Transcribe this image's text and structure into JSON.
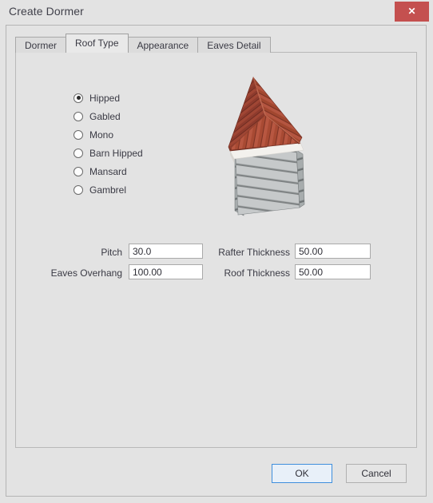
{
  "window": {
    "title": "Create Dormer",
    "close_label": "✕",
    "close_icon": "close-icon",
    "close_color": "#c4504f"
  },
  "tabs": [
    {
      "label": "Dormer",
      "active": false
    },
    {
      "label": "Roof Type",
      "active": true
    },
    {
      "label": "Appearance",
      "active": false
    },
    {
      "label": "Eaves Detail",
      "active": false
    }
  ],
  "roof_type": {
    "options": [
      {
        "label": "Hipped",
        "selected": true
      },
      {
        "label": "Gabled",
        "selected": false
      },
      {
        "label": "Mono",
        "selected": false
      },
      {
        "label": "Barn Hipped",
        "selected": false
      },
      {
        "label": "Mansard",
        "selected": false
      },
      {
        "label": "Gambrel",
        "selected": false
      }
    ]
  },
  "preview": {
    "name": "dormer-3d-preview",
    "roof_color": "#9e4233",
    "roof_shadow_color": "#7b3227",
    "roof_light_color": "#b2543f",
    "fascia_color": "#f2f0ec",
    "wall_color": "#b9bcbd",
    "wall_shadow_color": "#9ca0a1"
  },
  "fields": {
    "pitch": {
      "label": "Pitch",
      "value": "30.0"
    },
    "eaves_overhang": {
      "label": "Eaves Overhang",
      "value": "100.00"
    },
    "rafter_thickness": {
      "label": "Rafter Thickness",
      "value": "50.00"
    },
    "roof_thickness": {
      "label": "Roof Thickness",
      "value": "50.00"
    }
  },
  "buttons": {
    "ok": "OK",
    "cancel": "Cancel"
  }
}
